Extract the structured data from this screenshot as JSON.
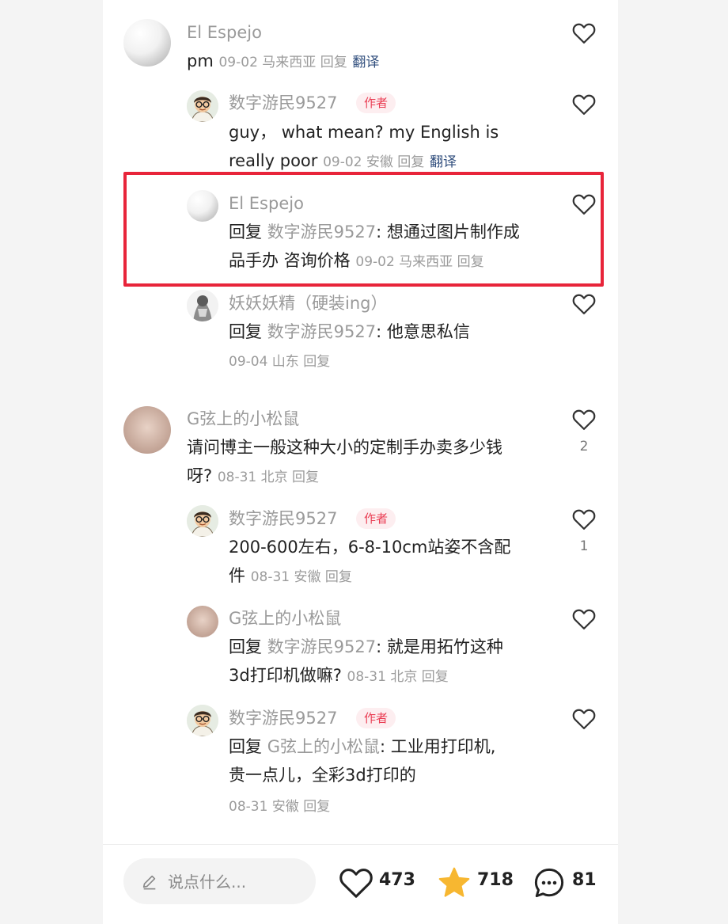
{
  "comments": [
    {
      "user": "El Espejo",
      "text": "pm",
      "meta": "09-02 马来西亚 回复",
      "translate": "翻译",
      "replies": [
        {
          "user": "数字游民9527",
          "tag": "作者",
          "text_line1": "guy， what mean?   my English is",
          "text_line2": "really poor",
          "meta": "09-02 安徽 回复",
          "translate": "翻译"
        },
        {
          "user": "El Espejo",
          "reply_prefix": "回复 ",
          "mention": "数字游民9527",
          "text_line1": ": 想通过图片制作成",
          "text_line2": "品手办 咨询价格",
          "meta": "09-02 马来西亚 回复"
        },
        {
          "user": "妖妖妖精（硬装ing）",
          "reply_prefix": "回复 ",
          "mention": "数字游民9527",
          "text_line1": ": 他意思私信",
          "meta": "09-04 山东 回复"
        }
      ]
    },
    {
      "user": "G弦上的小松鼠",
      "text_line1": "请问博主一般这种大小的定制手办卖多少钱",
      "text_line2": "呀?",
      "meta": "08-31 北京 回复",
      "likes": "2",
      "replies": [
        {
          "user": "数字游民9527",
          "tag": "作者",
          "text_line1": "200-600左右，6-8-10cm站姿不含配",
          "text_line2": "件",
          "meta": "08-31 安徽 回复",
          "likes": "1"
        },
        {
          "user": "G弦上的小松鼠",
          "reply_prefix": "回复 ",
          "mention": "数字游民9527",
          "text_line1": ": 就是用拓竹这种",
          "text_line2": "3d打印机做嘛?",
          "meta": "08-31 北京 回复"
        },
        {
          "user": "数字游民9527",
          "tag": "作者",
          "reply_prefix": "回复 ",
          "mention": "G弦上的小松鼠",
          "text_line1": ": 工业用打印机,",
          "text_line2": "贵一点儿，全彩3d打印的",
          "meta": "08-31 安徽 回复"
        }
      ]
    }
  ],
  "bottom_bar": {
    "placeholder": "说点什么...",
    "likes": "473",
    "stars": "718",
    "comments": "81"
  },
  "colors": {
    "author_tag": "#ea3e54",
    "highlight": "#e8243a",
    "star": "#f7b731",
    "translate": "#2f4d7c"
  }
}
